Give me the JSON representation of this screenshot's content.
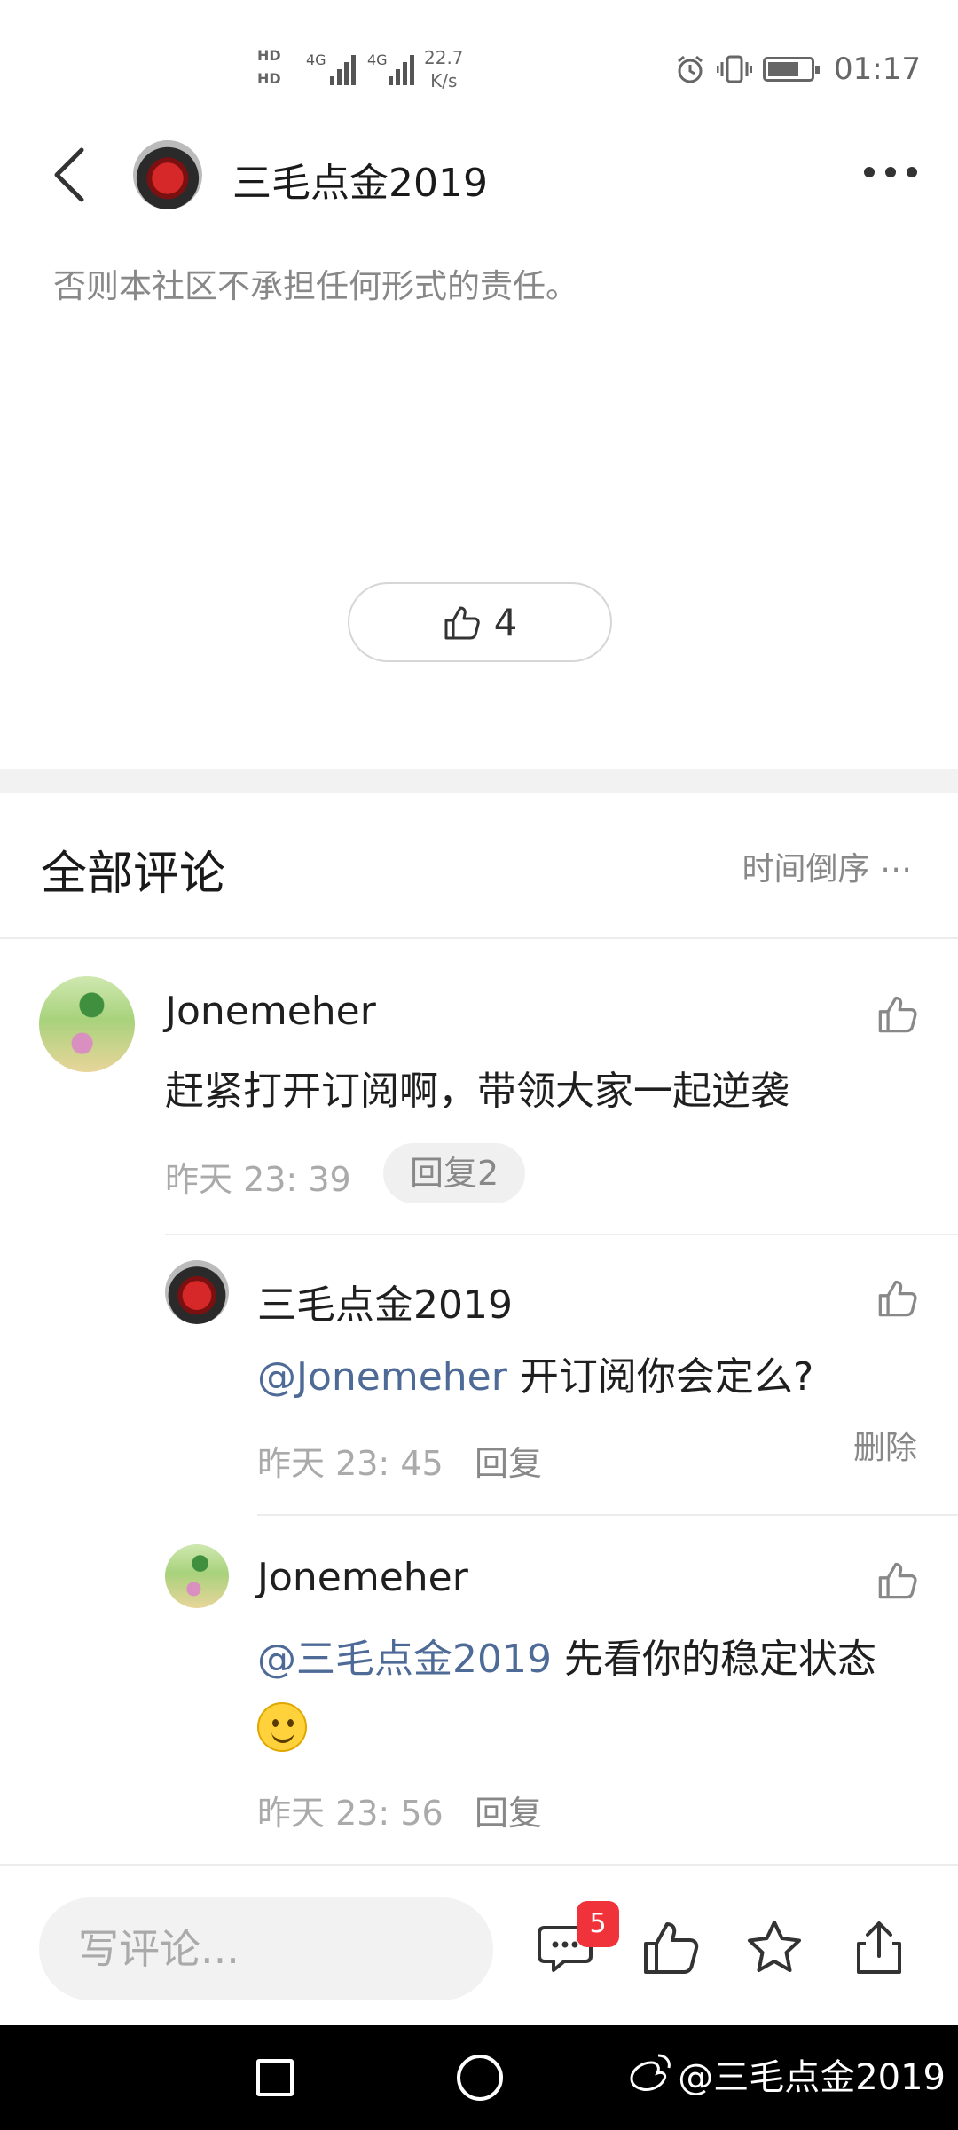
{
  "status_bar": {
    "hd1": "HD",
    "hd2": "HD",
    "net1": "4G",
    "net2": "4G",
    "speed_value": "22.7",
    "speed_unit": "K/s",
    "time": "01:17"
  },
  "header": {
    "title": "三毛点金2019"
  },
  "post": {
    "disclaimer": "否则本社区不承担任何形式的责任。",
    "like_count": "4"
  },
  "comments_section": {
    "title": "全部评论",
    "sort_label": "时间倒序 ⋯"
  },
  "comments": [
    {
      "author": "Jonemeher",
      "text": "赶紧打开订阅啊，带领大家一起逆袭",
      "time": "昨天 23: 39",
      "reply_chip": "回复2"
    }
  ],
  "replies": [
    {
      "author": "三毛点金2019",
      "mention": "@Jonemeher",
      "text": " 开订阅你会定么?",
      "time": "昨天 23: 45",
      "reply_label": "回复",
      "delete_label": "删除"
    },
    {
      "author": "Jonemeher",
      "mention": "@三毛点金2019",
      "text": " 先看你的稳定状态",
      "time": "昨天 23: 56",
      "reply_label": "回复"
    }
  ],
  "bottom_bar": {
    "input_placeholder": "写评论...",
    "comment_badge": "5"
  },
  "nav_bar": {
    "watermark": "@三毛点金2019"
  },
  "colors": {
    "mention": "#4e6a97",
    "badge": "#f0333b"
  }
}
